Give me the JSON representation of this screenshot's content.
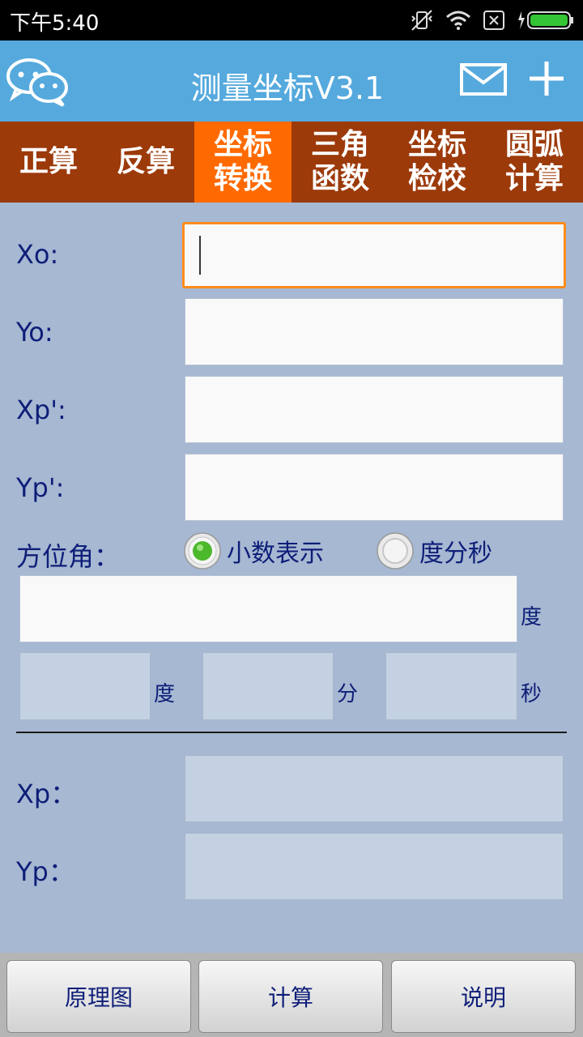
{
  "status_bar": {
    "time": "下午5:40"
  },
  "app": {
    "title": "测量坐标V3.1"
  },
  "tabs": [
    {
      "line1": "正算",
      "line2": ""
    },
    {
      "line1": "反算",
      "line2": ""
    },
    {
      "line1": "坐标",
      "line2": "转换"
    },
    {
      "line1": "三角",
      "line2": "函数"
    },
    {
      "line1": "坐标",
      "line2": "检校"
    },
    {
      "line1": "圆弧",
      "line2": "计算"
    }
  ],
  "form": {
    "xo_label": "Xo:",
    "yo_label": "Yo:",
    "xp_prime_label": "Xp':",
    "yp_prime_label": "Yp':",
    "azimuth_label": "方位角：",
    "radio_decimal": "小数表示",
    "radio_dms": "度分秒",
    "unit_degree": "度",
    "unit_minute": "分",
    "unit_second": "秒",
    "xp_label": "Xp：",
    "yp_label": "Yp："
  },
  "buttons": {
    "diagram": "原理图",
    "calculate": "计算",
    "help": "说明"
  },
  "colors": {
    "app_bar": "#55a9dd",
    "tab_bar": "#9c3a0a",
    "tab_active": "#ff6a00",
    "background": "#a6b8d2",
    "label_text": "#0e1e78",
    "focus_border": "#ff8c1a"
  }
}
